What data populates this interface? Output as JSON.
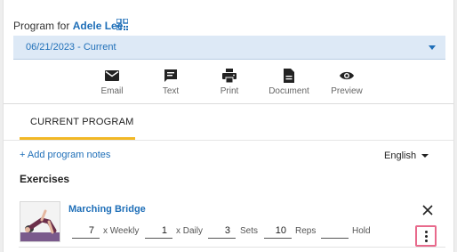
{
  "header": {
    "program_for_label": "Program for",
    "patient_name": "Adele Lee",
    "date_range": "06/21/2023 - Current"
  },
  "actions": [
    {
      "label": "Email",
      "icon": "email-icon"
    },
    {
      "label": "Text",
      "icon": "chat-icon"
    },
    {
      "label": "Print",
      "icon": "printer-icon"
    },
    {
      "label": "Document",
      "icon": "document-icon"
    },
    {
      "label": "Preview",
      "icon": "eye-icon"
    }
  ],
  "tabs": {
    "current": "CURRENT PROGRAM"
  },
  "notes": {
    "add_label": "+ Add program notes"
  },
  "language": {
    "selected": "English"
  },
  "exercises": {
    "title": "Exercises",
    "items": [
      {
        "name": "Marching Bridge",
        "weekly": "7",
        "weekly_label": "x Weekly",
        "daily": "1",
        "daily_label": "x Daily",
        "sets": "3",
        "sets_label": "Sets",
        "reps": "10",
        "reps_label": "Reps",
        "hold": "",
        "hold_label": "Hold"
      }
    ]
  },
  "colors": {
    "accent": "#1f6fb8",
    "tab_underline": "#f2b825",
    "select_bg": "#dde9f6",
    "highlight": "#e86a8c"
  }
}
